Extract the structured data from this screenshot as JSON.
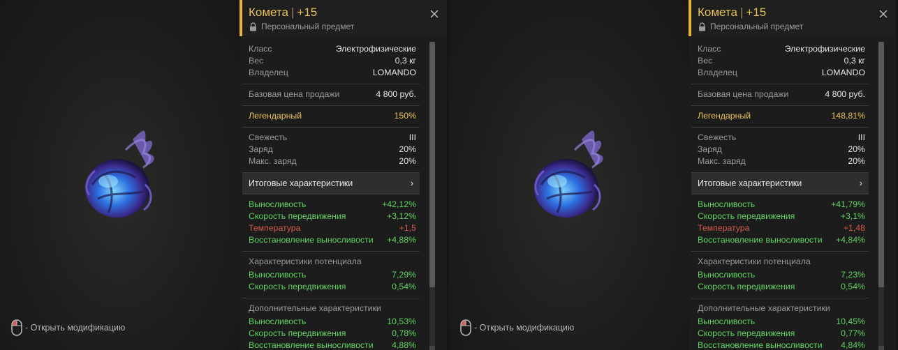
{
  "panels": [
    {
      "hint": {
        "icon": "mouse-icon",
        "text": "- Открыть модификацию"
      },
      "title": {
        "name": "Комета",
        "sep": "|",
        "level": "+15"
      },
      "subtitle": "Персональный предмет",
      "info": [
        {
          "k": "Класс",
          "v": "Электрофизические"
        },
        {
          "k": "Вес",
          "v": "0,3 кг"
        },
        {
          "k": "Владелец",
          "v": "LOMANDO"
        }
      ],
      "price": {
        "k": "Базовая цена продажи",
        "v": "4 800 руб."
      },
      "rarity": {
        "k": "Легендарный",
        "v": "150%"
      },
      "state": [
        {
          "k": "Свежесть",
          "v": "III"
        },
        {
          "k": "Заряд",
          "v": "20%"
        },
        {
          "k": "Макс. заряд",
          "v": "20%"
        }
      ],
      "summary": {
        "label": "Итоговые характеристики",
        "arrow": "›"
      },
      "totals": [
        {
          "k": "Выносливость",
          "v": "+42,12%",
          "c": "green"
        },
        {
          "k": "Скорость передвижения",
          "v": "+3,12%",
          "c": "green"
        },
        {
          "k": "Температура",
          "v": "+1,5",
          "c": "red"
        },
        {
          "k": "Восстановление выносливости",
          "v": "+4,88%",
          "c": "green"
        }
      ],
      "potential": {
        "title": "Характеристики потенциала",
        "rows": [
          {
            "k": "Выносливость",
            "v": "7,29%"
          },
          {
            "k": "Скорость передвижения",
            "v": "0,54%"
          }
        ]
      },
      "extra": {
        "title": "Дополнительные характеристики",
        "rows": [
          {
            "k": "Выносливость",
            "v": "10,53%"
          },
          {
            "k": "Скорость передвижения",
            "v": "0,78%"
          },
          {
            "k": "Восстановление выносливости",
            "v": "4,88%"
          }
        ]
      }
    },
    {
      "hint": {
        "icon": "mouse-icon",
        "text": "- Открыть модификацию"
      },
      "title": {
        "name": "Комета",
        "sep": "|",
        "level": "+15"
      },
      "subtitle": "Персональный предмет",
      "info": [
        {
          "k": "Класс",
          "v": "Электрофизические"
        },
        {
          "k": "Вес",
          "v": "0,3 кг"
        },
        {
          "k": "Владелец",
          "v": "LOMANDO"
        }
      ],
      "price": {
        "k": "Базовая цена продажи",
        "v": "4 800 руб."
      },
      "rarity": {
        "k": "Легендарный",
        "v": "148,81%"
      },
      "state": [
        {
          "k": "Свежесть",
          "v": "III"
        },
        {
          "k": "Заряд",
          "v": "20%"
        },
        {
          "k": "Макс. заряд",
          "v": "20%"
        }
      ],
      "summary": {
        "label": "Итоговые характеристики",
        "arrow": "›"
      },
      "totals": [
        {
          "k": "Выносливость",
          "v": "+41,79%",
          "c": "green"
        },
        {
          "k": "Скорость передвижения",
          "v": "+3,1%",
          "c": "green"
        },
        {
          "k": "Температура",
          "v": "+1,48",
          "c": "red"
        },
        {
          "k": "Восстановление выносливости",
          "v": "+4,84%",
          "c": "green"
        }
      ],
      "potential": {
        "title": "Характеристики потенциала",
        "rows": [
          {
            "k": "Выносливость",
            "v": "7,23%"
          },
          {
            "k": "Скорость передвижения",
            "v": "0,54%"
          }
        ]
      },
      "extra": {
        "title": "Дополнительные характеристики",
        "rows": [
          {
            "k": "Выносливость",
            "v": "10,45%"
          },
          {
            "k": "Скорость передвижения",
            "v": "0,77%"
          },
          {
            "k": "Восстановление выносливости",
            "v": "4,84%"
          }
        ]
      }
    }
  ],
  "colors": {
    "accent": "#e5b53a",
    "green": "#5fd35f",
    "red": "#d55a4e",
    "gold": "#e8c45a"
  }
}
